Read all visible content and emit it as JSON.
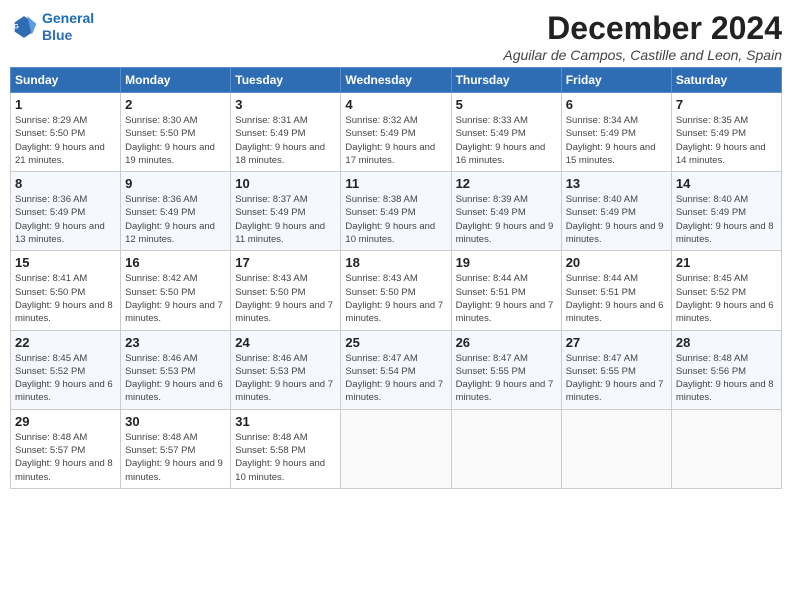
{
  "logo": {
    "line1": "General",
    "line2": "Blue"
  },
  "title": "December 2024",
  "subtitle": "Aguilar de Campos, Castille and Leon, Spain",
  "days_header": [
    "Sunday",
    "Monday",
    "Tuesday",
    "Wednesday",
    "Thursday",
    "Friday",
    "Saturday"
  ],
  "weeks": [
    [
      {
        "day": "1",
        "sunrise": "Sunrise: 8:29 AM",
        "sunset": "Sunset: 5:50 PM",
        "daylight": "Daylight: 9 hours and 21 minutes."
      },
      {
        "day": "2",
        "sunrise": "Sunrise: 8:30 AM",
        "sunset": "Sunset: 5:50 PM",
        "daylight": "Daylight: 9 hours and 19 minutes."
      },
      {
        "day": "3",
        "sunrise": "Sunrise: 8:31 AM",
        "sunset": "Sunset: 5:49 PM",
        "daylight": "Daylight: 9 hours and 18 minutes."
      },
      {
        "day": "4",
        "sunrise": "Sunrise: 8:32 AM",
        "sunset": "Sunset: 5:49 PM",
        "daylight": "Daylight: 9 hours and 17 minutes."
      },
      {
        "day": "5",
        "sunrise": "Sunrise: 8:33 AM",
        "sunset": "Sunset: 5:49 PM",
        "daylight": "Daylight: 9 hours and 16 minutes."
      },
      {
        "day": "6",
        "sunrise": "Sunrise: 8:34 AM",
        "sunset": "Sunset: 5:49 PM",
        "daylight": "Daylight: 9 hours and 15 minutes."
      },
      {
        "day": "7",
        "sunrise": "Sunrise: 8:35 AM",
        "sunset": "Sunset: 5:49 PM",
        "daylight": "Daylight: 9 hours and 14 minutes."
      }
    ],
    [
      {
        "day": "8",
        "sunrise": "Sunrise: 8:36 AM",
        "sunset": "Sunset: 5:49 PM",
        "daylight": "Daylight: 9 hours and 13 minutes."
      },
      {
        "day": "9",
        "sunrise": "Sunrise: 8:36 AM",
        "sunset": "Sunset: 5:49 PM",
        "daylight": "Daylight: 9 hours and 12 minutes."
      },
      {
        "day": "10",
        "sunrise": "Sunrise: 8:37 AM",
        "sunset": "Sunset: 5:49 PM",
        "daylight": "Daylight: 9 hours and 11 minutes."
      },
      {
        "day": "11",
        "sunrise": "Sunrise: 8:38 AM",
        "sunset": "Sunset: 5:49 PM",
        "daylight": "Daylight: 9 hours and 10 minutes."
      },
      {
        "day": "12",
        "sunrise": "Sunrise: 8:39 AM",
        "sunset": "Sunset: 5:49 PM",
        "daylight": "Daylight: 9 hours and 9 minutes."
      },
      {
        "day": "13",
        "sunrise": "Sunrise: 8:40 AM",
        "sunset": "Sunset: 5:49 PM",
        "daylight": "Daylight: 9 hours and 9 minutes."
      },
      {
        "day": "14",
        "sunrise": "Sunrise: 8:40 AM",
        "sunset": "Sunset: 5:49 PM",
        "daylight": "Daylight: 9 hours and 8 minutes."
      }
    ],
    [
      {
        "day": "15",
        "sunrise": "Sunrise: 8:41 AM",
        "sunset": "Sunset: 5:50 PM",
        "daylight": "Daylight: 9 hours and 8 minutes."
      },
      {
        "day": "16",
        "sunrise": "Sunrise: 8:42 AM",
        "sunset": "Sunset: 5:50 PM",
        "daylight": "Daylight: 9 hours and 7 minutes."
      },
      {
        "day": "17",
        "sunrise": "Sunrise: 8:43 AM",
        "sunset": "Sunset: 5:50 PM",
        "daylight": "Daylight: 9 hours and 7 minutes."
      },
      {
        "day": "18",
        "sunrise": "Sunrise: 8:43 AM",
        "sunset": "Sunset: 5:50 PM",
        "daylight": "Daylight: 9 hours and 7 minutes."
      },
      {
        "day": "19",
        "sunrise": "Sunrise: 8:44 AM",
        "sunset": "Sunset: 5:51 PM",
        "daylight": "Daylight: 9 hours and 7 minutes."
      },
      {
        "day": "20",
        "sunrise": "Sunrise: 8:44 AM",
        "sunset": "Sunset: 5:51 PM",
        "daylight": "Daylight: 9 hours and 6 minutes."
      },
      {
        "day": "21",
        "sunrise": "Sunrise: 8:45 AM",
        "sunset": "Sunset: 5:52 PM",
        "daylight": "Daylight: 9 hours and 6 minutes."
      }
    ],
    [
      {
        "day": "22",
        "sunrise": "Sunrise: 8:45 AM",
        "sunset": "Sunset: 5:52 PM",
        "daylight": "Daylight: 9 hours and 6 minutes."
      },
      {
        "day": "23",
        "sunrise": "Sunrise: 8:46 AM",
        "sunset": "Sunset: 5:53 PM",
        "daylight": "Daylight: 9 hours and 6 minutes."
      },
      {
        "day": "24",
        "sunrise": "Sunrise: 8:46 AM",
        "sunset": "Sunset: 5:53 PM",
        "daylight": "Daylight: 9 hours and 7 minutes."
      },
      {
        "day": "25",
        "sunrise": "Sunrise: 8:47 AM",
        "sunset": "Sunset: 5:54 PM",
        "daylight": "Daylight: 9 hours and 7 minutes."
      },
      {
        "day": "26",
        "sunrise": "Sunrise: 8:47 AM",
        "sunset": "Sunset: 5:55 PM",
        "daylight": "Daylight: 9 hours and 7 minutes."
      },
      {
        "day": "27",
        "sunrise": "Sunrise: 8:47 AM",
        "sunset": "Sunset: 5:55 PM",
        "daylight": "Daylight: 9 hours and 7 minutes."
      },
      {
        "day": "28",
        "sunrise": "Sunrise: 8:48 AM",
        "sunset": "Sunset: 5:56 PM",
        "daylight": "Daylight: 9 hours and 8 minutes."
      }
    ],
    [
      {
        "day": "29",
        "sunrise": "Sunrise: 8:48 AM",
        "sunset": "Sunset: 5:57 PM",
        "daylight": "Daylight: 9 hours and 8 minutes."
      },
      {
        "day": "30",
        "sunrise": "Sunrise: 8:48 AM",
        "sunset": "Sunset: 5:57 PM",
        "daylight": "Daylight: 9 hours and 9 minutes."
      },
      {
        "day": "31",
        "sunrise": "Sunrise: 8:48 AM",
        "sunset": "Sunset: 5:58 PM",
        "daylight": "Daylight: 9 hours and 10 minutes."
      },
      null,
      null,
      null,
      null
    ]
  ]
}
